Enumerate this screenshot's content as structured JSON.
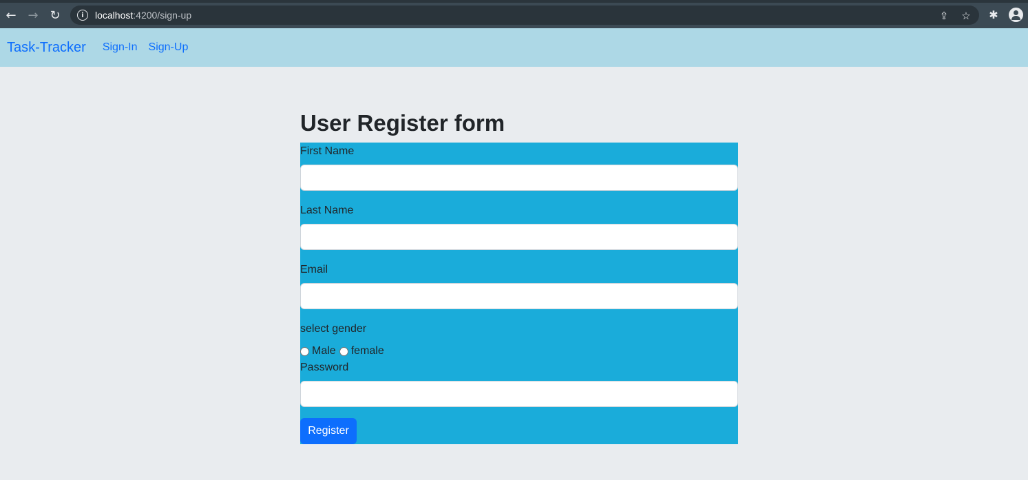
{
  "browser": {
    "url_host": "localhost",
    "url_path": ":4200/sign-up",
    "back_icon": "arrow-left",
    "forward_icon": "arrow-right",
    "reload_icon": "reload",
    "info_icon": "info-circle",
    "share_icon": "share",
    "star_icon": "star",
    "extensions_icon": "puzzle",
    "profile_icon": "account-circle"
  },
  "navbar": {
    "brand": "Task-Tracker",
    "links": [
      "Sign-In",
      "Sign-Up"
    ],
    "background": "#add8e6",
    "link_color": "#0d6efd"
  },
  "form": {
    "title": "User Register form",
    "background": "#1aacda",
    "first_name_label": "First Name",
    "first_name_value": "",
    "last_name_label": "Last Name",
    "last_name_value": "",
    "email_label": "Email",
    "email_value": "",
    "gender_label": "select gender",
    "gender_options": [
      "Male",
      "female"
    ],
    "password_label": "Password",
    "password_value": "",
    "submit_label": "Register",
    "submit_color": "#0d6efd"
  }
}
